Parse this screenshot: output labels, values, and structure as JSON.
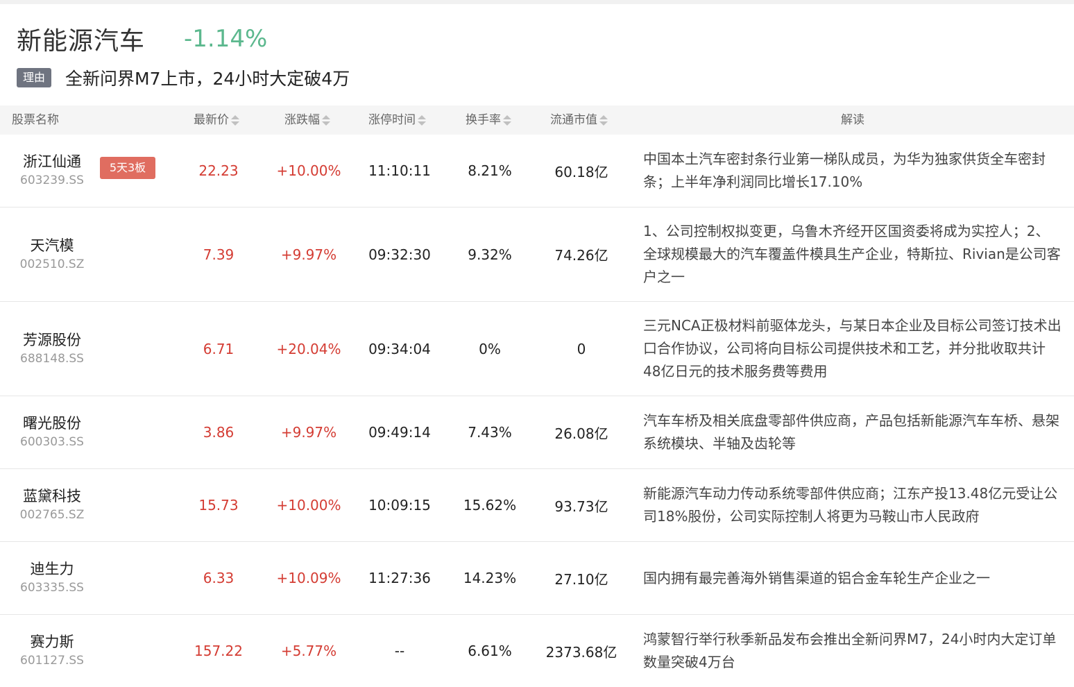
{
  "sector": {
    "name": "新能源汽车",
    "change": "-1.14%"
  },
  "reason": {
    "tag": "理由",
    "text": "全新问界M7上市，24小时大定破4万"
  },
  "columns": {
    "name": "股票名称",
    "price": "最新价",
    "change": "涨跌幅",
    "limit_time": "涨停时间",
    "turnover": "换手率",
    "float_cap": "流通市值",
    "interpretation": "解读"
  },
  "rows": [
    {
      "name": "浙江仙通",
      "code": "603239.SS",
      "badge": "5天3板",
      "price": "22.23",
      "change": "+10.00%",
      "time": "11:10:11",
      "turnover": "8.21%",
      "cap": "60.18亿",
      "desc": "中国本土汽车密封条行业第一梯队成员，为华为独家供货全车密封条；上半年净利润同比增长17.10%"
    },
    {
      "name": "天汽模",
      "code": "002510.SZ",
      "price": "7.39",
      "change": "+9.97%",
      "time": "09:32:30",
      "turnover": "9.32%",
      "cap": "74.26亿",
      "desc": "1、公司控制权拟变更，乌鲁木齐经开区国资委将成为实控人；2、全球规模最大的汽车覆盖件模具生产企业，特斯拉、Rivian是公司客户之一"
    },
    {
      "name": "芳源股份",
      "code": "688148.SS",
      "price": "6.71",
      "change": "+20.04%",
      "time": "09:34:04",
      "turnover": "0%",
      "cap": "0",
      "desc": "三元NCA正极材料前驱体龙头，与某日本企业及目标公司签订技术出口合作协议，公司将向目标公司提供技术和工艺，并分批收取共计48亿日元的技术服务费等费用"
    },
    {
      "name": "曙光股份",
      "code": "600303.SS",
      "price": "3.86",
      "change": "+9.97%",
      "time": "09:49:14",
      "turnover": "7.43%",
      "cap": "26.08亿",
      "desc": "汽车车桥及相关底盘零部件供应商，产品包括新能源汽车车桥、悬架系统模块、半轴及齿轮等"
    },
    {
      "name": "蓝黛科技",
      "code": "002765.SZ",
      "price": "15.73",
      "change": "+10.00%",
      "time": "10:09:15",
      "turnover": "15.62%",
      "cap": "93.73亿",
      "desc": "新能源汽车动力传动系统零部件供应商；江东产投13.48亿元受让公司18%股份，公司实际控制人将更为马鞍山市人民政府"
    },
    {
      "name": "迪生力",
      "code": "603335.SS",
      "price": "6.33",
      "change": "+10.09%",
      "time": "11:27:36",
      "turnover": "14.23%",
      "cap": "27.10亿",
      "desc": "国内拥有最完善海外销售渠道的铝合金车轮生产企业之一"
    },
    {
      "name": "赛力斯",
      "code": "601127.SS",
      "price": "157.22",
      "change": "+5.77%",
      "time": "--",
      "turnover": "6.61%",
      "cap": "2373.68亿",
      "desc": "鸿蒙智行举行秋季新品发布会推出全新问界M7，24小时内大定订单数量突破4万台"
    }
  ]
}
